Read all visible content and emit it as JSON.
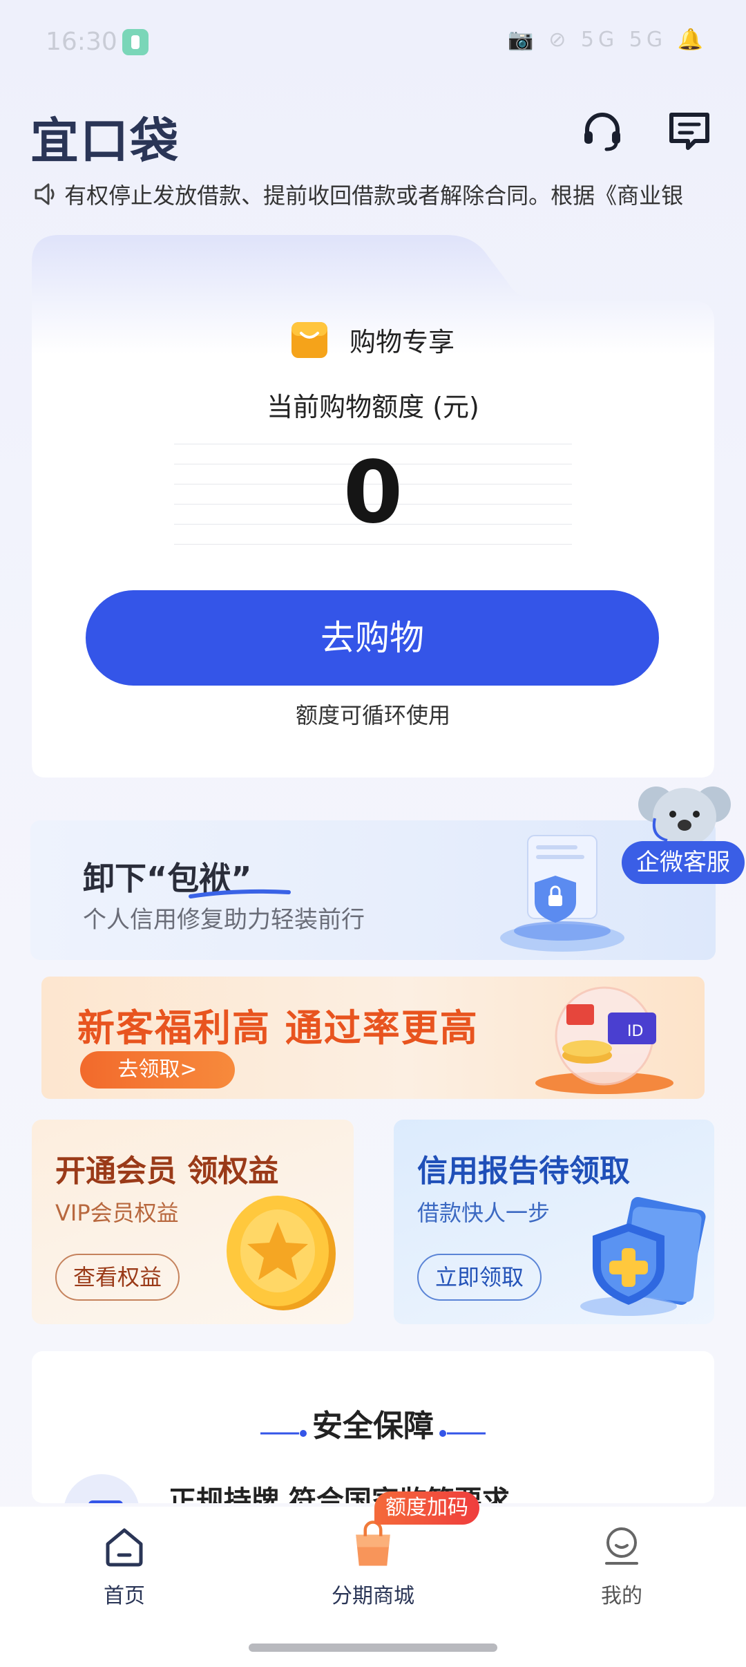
{
  "status_bar": {
    "time": "16:30",
    "right_icons": "📷 ⊘ 5G 5G 🔔"
  },
  "header": {
    "logo_text": "宜口袋",
    "icons": [
      "headset-icon",
      "message-icon"
    ]
  },
  "notice": {
    "icon": "speaker-icon",
    "text": "有权停止发放借款、提前收回借款或者解除合同。根据《商业银"
  },
  "quota_card": {
    "tag": "购物专享",
    "label": "当前购物额度 (元)",
    "value": "0",
    "button": "去购物",
    "note": "额度可循环使用"
  },
  "floating_service": {
    "label": "企微客服"
  },
  "banner_relief": {
    "title": "卸下“包袱”",
    "subtitle": "个人信用修复助力轻装前行"
  },
  "banner_newuser": {
    "title": "新客福利高 通过率更高",
    "button": "去领取>"
  },
  "card_vip": {
    "title": "开通会员 领权益",
    "subtitle": "VIP会员权益",
    "button": "查看权益"
  },
  "card_credit": {
    "title": "信用报告待领取",
    "subtitle": "借款快人一步",
    "button": "立即领取"
  },
  "security": {
    "title": "安全保障",
    "item": "正规持牌 符合国家监管要求"
  },
  "bottom_nav": {
    "items": [
      {
        "label": "首页",
        "icon": "home-icon"
      },
      {
        "label": "分期商城",
        "icon": "shopping-bag-icon"
      },
      {
        "label": "我的",
        "icon": "profile-icon"
      }
    ],
    "badge": "额度加码"
  },
  "colors": {
    "primary": "#3455e8",
    "orange": "#e8541f",
    "dark_text": "#222222"
  }
}
